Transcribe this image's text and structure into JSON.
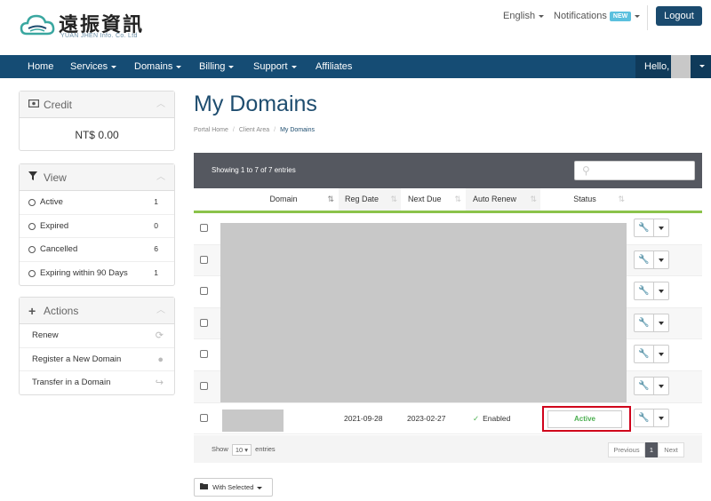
{
  "brand": {
    "name_cn": "遠振資訊",
    "name_en": "YUAN JHEN Info. Co. Ltd"
  },
  "topbar": {
    "language": "English",
    "notifications": "Notifications",
    "new_badge": "NEW",
    "logout": "Logout"
  },
  "nav": {
    "items": [
      "Home",
      "Services",
      "Domains",
      "Billing",
      "Support",
      "Affiliates"
    ],
    "hello": "Hello,"
  },
  "sidebar": {
    "credit": {
      "title": "Credit",
      "value": "NT$ 0.00"
    },
    "view": {
      "title": "View",
      "items": [
        {
          "label": "Active",
          "count": "1"
        },
        {
          "label": "Expired",
          "count": "0"
        },
        {
          "label": "Cancelled",
          "count": "6"
        },
        {
          "label": "Expiring within 90 Days",
          "count": "1"
        }
      ]
    },
    "actions": {
      "title": "Actions",
      "items": [
        {
          "label": "Renew"
        },
        {
          "label": "Register a New Domain"
        },
        {
          "label": "Transfer in a Domain"
        }
      ]
    }
  },
  "main": {
    "title": "My Domains",
    "breadcrumb": [
      "Portal Home",
      "Client Area",
      "My Domains"
    ],
    "table_info": "Showing 1 to 7 of 7 entries",
    "columns": [
      "Domain",
      "Reg Date",
      "Next Due",
      "Auto Renew",
      "Status"
    ],
    "last_row": {
      "reg_date": "2021-09-28",
      "next_due": "2023-02-27",
      "auto_renew": "Enabled",
      "status": "Active"
    },
    "footer": {
      "show": "Show",
      "page_size": "10",
      "entries": "entries",
      "previous": "Previous",
      "page": "1",
      "next": "Next"
    },
    "with_selected": "With Selected"
  },
  "colors": {
    "nav": "#154c74",
    "title": "#1e4d6f",
    "accent_green": "#8bc34a",
    "highlight": "#d0021b"
  }
}
